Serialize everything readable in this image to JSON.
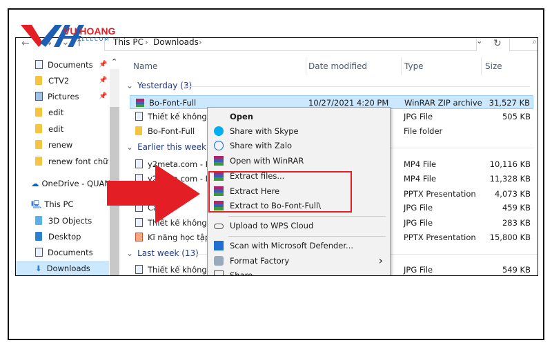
{
  "logo": {
    "text": "VU HOANG",
    "subtext": "TELECOM"
  },
  "toolbar": {
    "back": "←",
    "forward": "→",
    "down": "⌄",
    "up": "↑",
    "breadcrumb": [
      "This PC",
      "Downloads"
    ],
    "refresh": "↻",
    "search": "⌕",
    "dropdown": "⌄"
  },
  "sidebar": {
    "pinned": [
      {
        "label": "Documents",
        "icon": "documents-icon"
      },
      {
        "label": "CTV2",
        "icon": "folder-icon"
      },
      {
        "label": "Pictures",
        "icon": "pictures-icon"
      }
    ],
    "folders": [
      "edit",
      "edit",
      "renew",
      "renew font chữ"
    ],
    "onedrive": "OneDrive - QUAN",
    "thispc": "This PC",
    "pc_items": [
      "3D Objects",
      "Desktop",
      "Documents",
      "Downloads"
    ]
  },
  "columns": {
    "name": "Name",
    "date": "Date modified",
    "type": "Type",
    "size": "Size"
  },
  "groups": [
    {
      "label": "Yesterday (3)",
      "rows": [
        {
          "name": "Bo-Font-Full",
          "date": "10/27/2021 4:20 PM",
          "type": "WinRAR ZIP archive",
          "size": "31,527 KB",
          "icon": "rar"
        },
        {
          "name": "Thiết kế không tê",
          "type": "JPG File",
          "size": "505 KB",
          "icon": "file"
        },
        {
          "name": "Bo-Font-Full",
          "type": "File folder",
          "size": "",
          "icon": "folder"
        }
      ]
    },
    {
      "label": "Earlier this week (6)",
      "rows": [
        {
          "name": "y2meta.com - Hu",
          "type": "MP4 File",
          "size": "10,116 KB",
          "icon": "file"
        },
        {
          "name": "y2meta.com - Là",
          "type": "MP4 File",
          "size": "11,328 KB",
          "icon": "file"
        },
        {
          "name": "",
          "type": "PPTX Presentation",
          "size": "4,073 KB",
          "icon": "ppt"
        },
        {
          "name": "Cá 1",
          "type": "JPG File",
          "size": "459 KB",
          "icon": "file"
        },
        {
          "name": "Thiết kế không tê",
          "type": "JPG File",
          "size": "283 KB",
          "icon": "file"
        },
        {
          "name": "Kĩ năng học tập",
          "type": "PPTX Presentation",
          "size": "15,800 KB",
          "icon": "ppt"
        }
      ]
    },
    {
      "label": "Last week (13)",
      "rows": [
        {
          "name": "Thiết kế không tê",
          "type": "JPG File",
          "size": "549 KB",
          "icon": "file"
        }
      ]
    }
  ],
  "menu": {
    "items": [
      "Open",
      "Share with Skype",
      "Share with Zalo",
      "Open with WinRAR",
      "Extract files...",
      "Extract Here",
      "Extract to Bo-Font-Full\\",
      "Upload to WPS Cloud",
      "Scan with Microsoft Defender...",
      "Format Factory",
      "Share"
    ],
    "submenu_arrow": "›"
  },
  "colors": {
    "highlight": "#e31e24",
    "selection": "#cce8ff",
    "arrow": "#e31e24"
  }
}
